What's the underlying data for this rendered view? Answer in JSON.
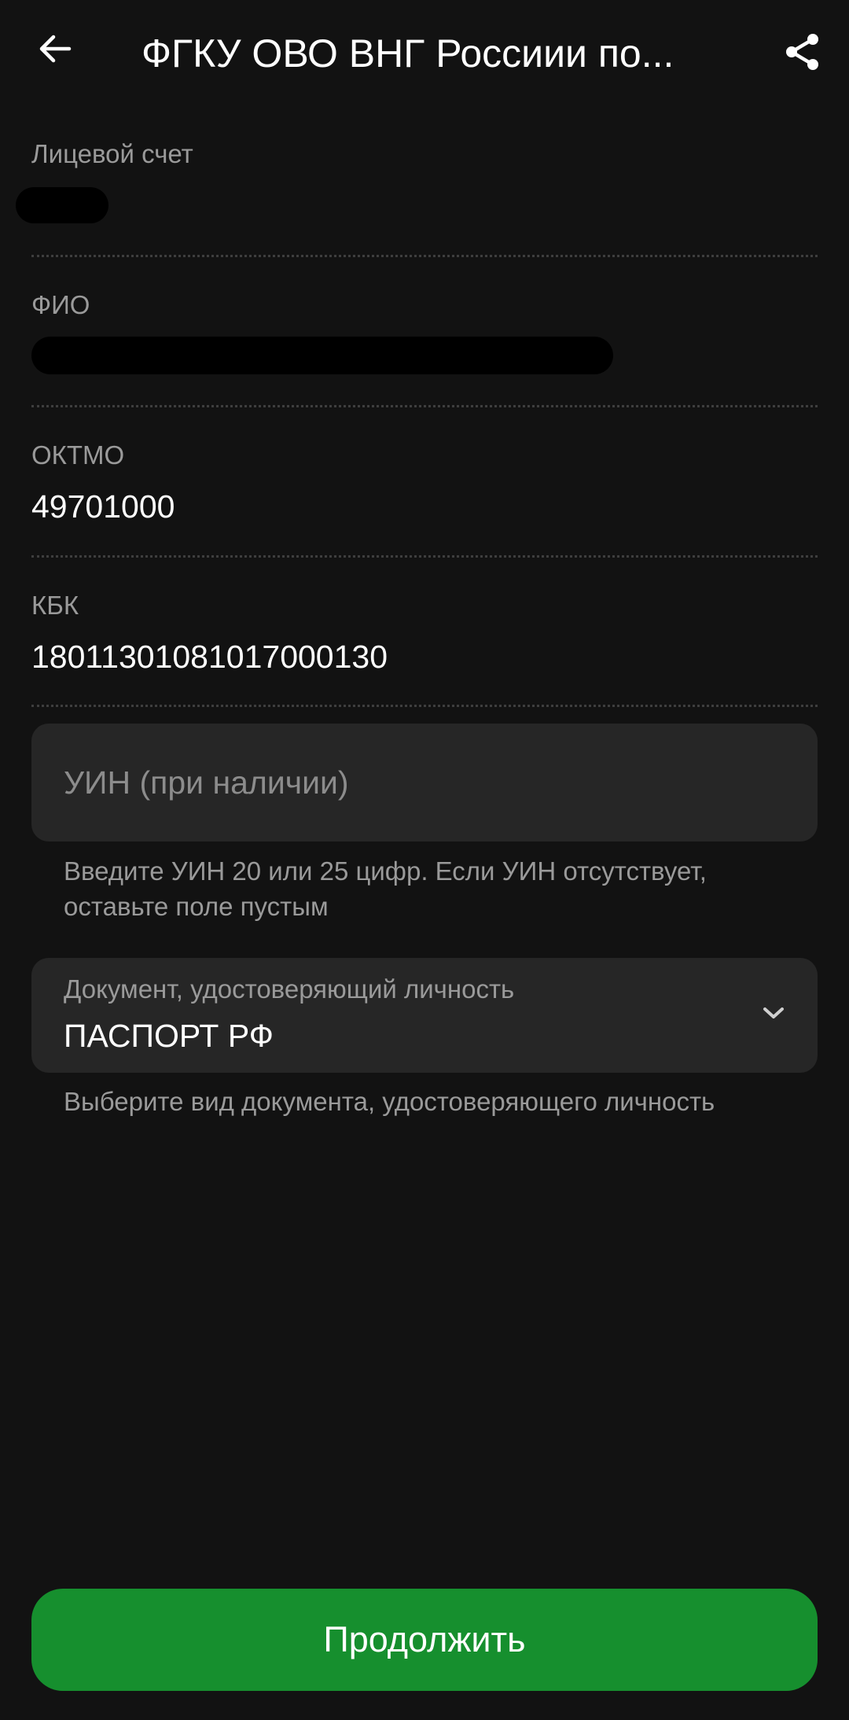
{
  "header": {
    "title": "ФГКУ ОВО ВНГ Россиии по...",
    "back_icon": "arrow-left-icon",
    "share_icon": "share-icon"
  },
  "fields": {
    "account": {
      "label": "Лицевой счет",
      "value": ""
    },
    "fio": {
      "label": "ФИО",
      "value": ""
    },
    "oktmo": {
      "label": "ОКТМО",
      "value": "49701000"
    },
    "kbk": {
      "label": "КБК",
      "value": "18011301081017000130"
    }
  },
  "uin": {
    "placeholder": "УИН (при наличии)",
    "value": "",
    "hint": "Введите УИН 20 или 25 цифр. Если УИН отсутствует, оставьте поле пустым"
  },
  "document": {
    "label": "Документ, удостоверяющий личность",
    "value": "ПАСПОРТ РФ",
    "hint": "Выберите вид документа, удостоверяющего личность",
    "chevron_icon": "chevron-down-icon"
  },
  "actions": {
    "continue_label": "Продолжить"
  },
  "colors": {
    "background": "#121212",
    "surface": "#262626",
    "accent": "#168f2e",
    "secondary_text": "#9a9a9a"
  }
}
